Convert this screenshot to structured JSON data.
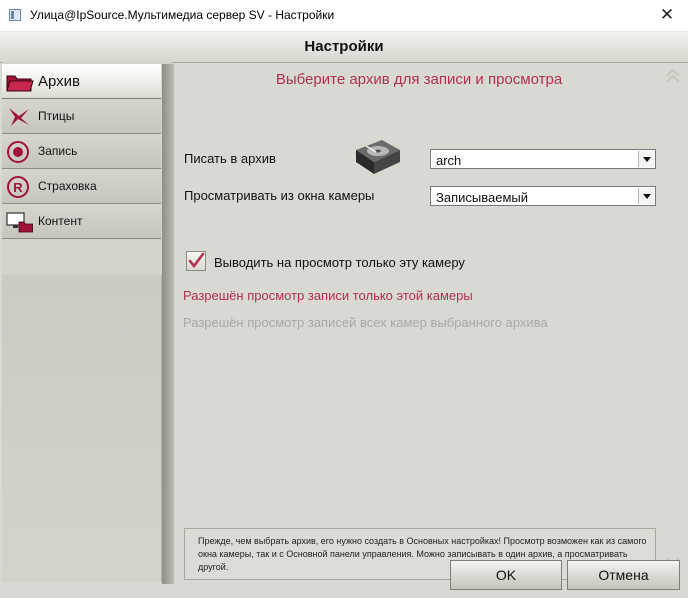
{
  "window": {
    "title": "Улица@IpSource.Мультимедиа сервер SV - Настройки"
  },
  "header": {
    "title": "Настройки"
  },
  "sidebar": {
    "items": [
      {
        "label": "Архив",
        "icon": "folder-icon",
        "active": true
      },
      {
        "label": "Птицы",
        "icon": "bird-icon",
        "active": false
      },
      {
        "label": "Запись",
        "icon": "record-icon",
        "active": false
      },
      {
        "label": "Страховка",
        "icon": "registered-icon",
        "active": false
      },
      {
        "label": "Контент",
        "icon": "monitor-folder-icon",
        "active": false
      }
    ]
  },
  "main": {
    "heading": "Выберите архив для записи и просмотра",
    "write_label": "Писать в архив",
    "write_value": "arch",
    "view_label": "Просматривать из окна камеры",
    "view_value": "Записываемый",
    "checkbox_label": "Выводить на просмотр только эту камеру",
    "checkbox_checked": true,
    "option_single": "Разрешён просмотр записи только этой камеры",
    "option_all": "Разрешён просмотр записей всех камер выбранного архива",
    "note": "Прежде, чем выбрать архив, его нужно создать в Основных настройках! Просмотр возможен как из самого окна камеры, так и с Основной панели управления. Можно записывать в один архив, а просматривать другой."
  },
  "buttons": {
    "ok": "OK",
    "cancel": "Отмена"
  },
  "colors": {
    "accent": "#b1304e",
    "disabled": "#a9a9a3",
    "panel": "#d9d9d3"
  }
}
